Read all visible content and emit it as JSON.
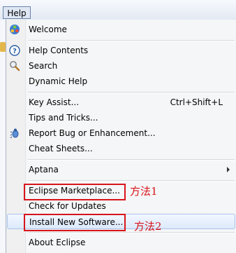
{
  "menubar": {
    "title": "Help"
  },
  "menu": {
    "items": {
      "welcome": "Welcome",
      "help_contents": "Help Contents",
      "search": "Search",
      "dynamic_help": "Dynamic Help",
      "key_assist": "Key Assist...",
      "key_assist_shortcut": "Ctrl+Shift+L",
      "tips_and_tricks": "Tips and Tricks...",
      "report_bug": "Report Bug or Enhancement...",
      "cheat_sheets": "Cheat Sheets...",
      "aptana": "Aptana",
      "eclipse_marketplace": "Eclipse Marketplace...",
      "check_for_updates": "Check for Updates",
      "install_new_software": "Install New Software...",
      "about_eclipse": "About Eclipse"
    }
  },
  "annotations": {
    "method1": "方法1",
    "method2": "方法2"
  },
  "colors": {
    "annotation": "#d9141b",
    "hover_bg": "#dce9fb"
  }
}
